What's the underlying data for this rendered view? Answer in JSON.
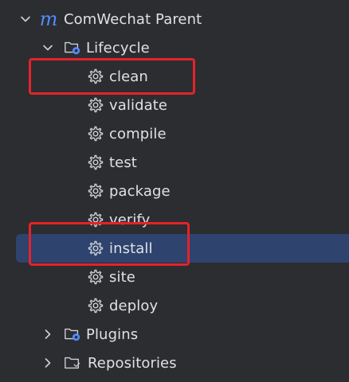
{
  "tree": {
    "root": {
      "label": "ComWechat Parent",
      "icon": "maven-m-icon",
      "logo_letter": "m",
      "expanded": true
    },
    "lifecycle": {
      "label": "Lifecycle",
      "icon": "folder-gear-icon",
      "expanded": true,
      "phases": [
        {
          "label": "clean"
        },
        {
          "label": "validate"
        },
        {
          "label": "compile"
        },
        {
          "label": "test"
        },
        {
          "label": "package"
        },
        {
          "label": "verify"
        },
        {
          "label": "install",
          "selected": true
        },
        {
          "label": "site"
        },
        {
          "label": "deploy"
        }
      ]
    },
    "plugins": {
      "label": "Plugins",
      "icon": "folder-gear-icon",
      "expanded": false
    },
    "repositories": {
      "label": "Repositories",
      "icon": "folder-icon",
      "expanded": false
    }
  },
  "colors": {
    "background": "#2b2d30",
    "text": "#dfe1e5",
    "selection": "#2e436e",
    "annotation": "#e5222a",
    "maven_blue": "#548af7",
    "icon_gray": "#ced0d6"
  }
}
